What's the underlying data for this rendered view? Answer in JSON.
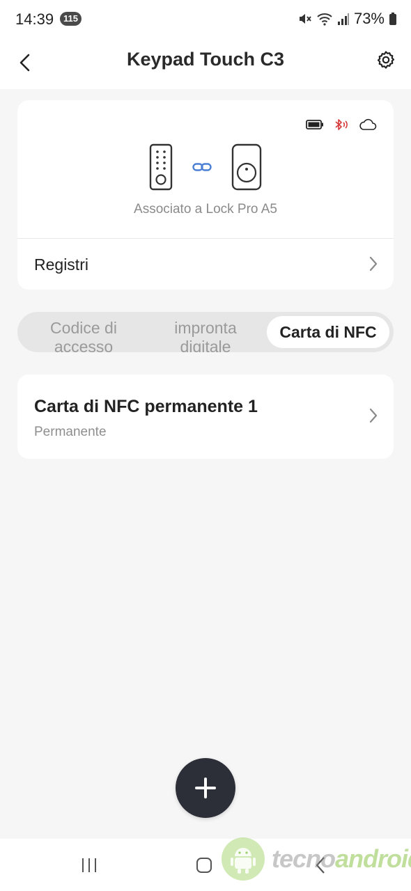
{
  "status_bar": {
    "time": "14:39",
    "notification_count": "115",
    "battery_percent": "73%"
  },
  "header": {
    "title": "Keypad Touch C3"
  },
  "device_card": {
    "associated_text": "Associato a Lock Pro A5",
    "logs_label": "Registri"
  },
  "tabs": [
    {
      "label": "Codice di accesso",
      "active": false
    },
    {
      "label": "impronta digitale",
      "active": false
    },
    {
      "label": "Carta di NFC",
      "active": true
    }
  ],
  "list": [
    {
      "title": "Carta di NFC permanente 1",
      "subtitle": "Permanente"
    }
  ],
  "watermark": {
    "part1": "tecno",
    "part2": "android"
  },
  "colors": {
    "background": "#f6f6f6",
    "fab": "#2c2f38",
    "link_accent": "#4a7fd4",
    "bluetooth_red": "#d63a3a"
  }
}
